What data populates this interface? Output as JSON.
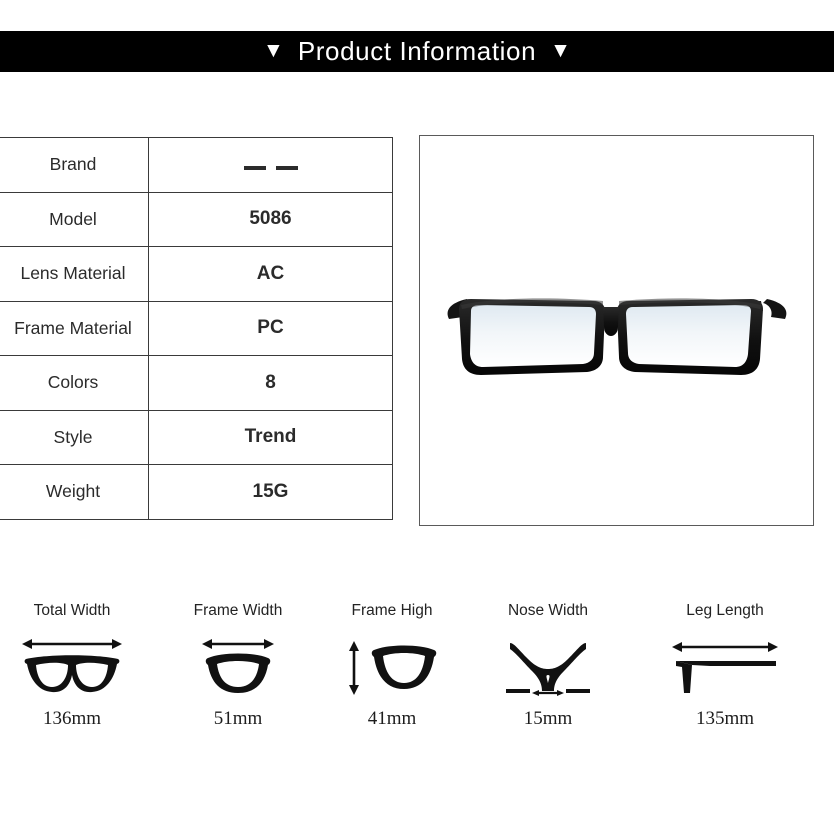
{
  "header": {
    "title": "Product Information",
    "left_marker": "▼",
    "right_marker": "▼",
    "background_color": "#000000",
    "text_color": "#ffffff"
  },
  "spec_table": {
    "rows": [
      {
        "label": "Brand",
        "value": "— —",
        "value_is_dashes": true
      },
      {
        "label": "Model",
        "value": "5086"
      },
      {
        "label": "Lens Material",
        "value": "AC"
      },
      {
        "label": "Frame Material",
        "value": "PC"
      },
      {
        "label": "Colors",
        "value": "8"
      },
      {
        "label": "Style",
        "value": "Trend"
      },
      {
        "label": "Weight",
        "value": "15G"
      }
    ]
  },
  "product_photo": {
    "alt": "black rectangular eyeglasses front view",
    "frame_color": "#111111",
    "accent_color": "#2b3fb5",
    "lens_color": "#eef3f7"
  },
  "measurements": [
    {
      "label": "Total Width",
      "value": "136mm",
      "icon": "glasses-full-frame-width-icon"
    },
    {
      "label": "Frame Width",
      "value": "51mm",
      "icon": "single-lens-width-icon"
    },
    {
      "label": "Frame High",
      "value": "41mm",
      "icon": "single-lens-height-icon"
    },
    {
      "label": "Nose Width",
      "value": "15mm",
      "icon": "nose-bridge-icon"
    },
    {
      "label": "Leg Length",
      "value": "135mm",
      "icon": "temple-arm-icon"
    }
  ]
}
